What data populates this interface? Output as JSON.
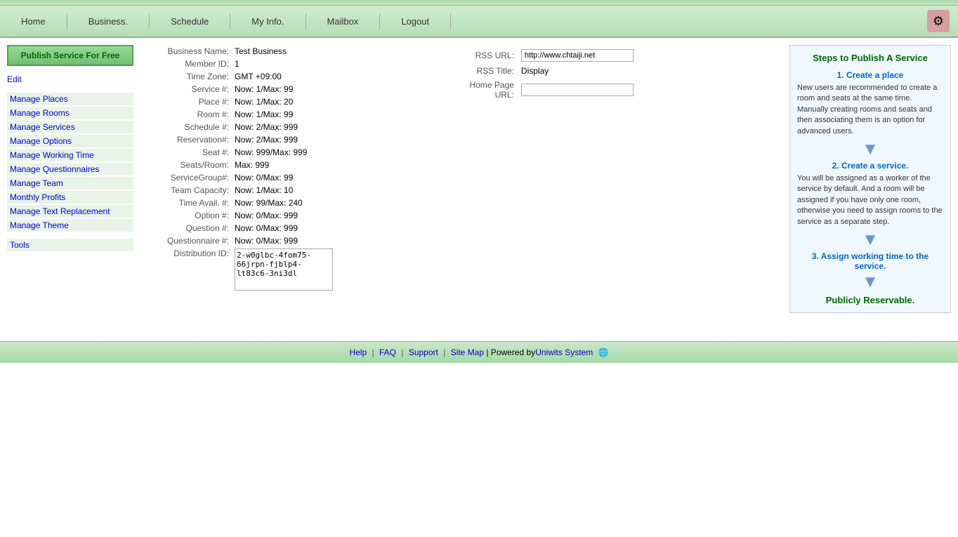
{
  "nav": {
    "items": [
      {
        "label": "Home",
        "href": "#"
      },
      {
        "label": "Business.",
        "href": "#"
      },
      {
        "label": "Schedule",
        "href": "#"
      },
      {
        "label": "My Info.",
        "href": "#"
      },
      {
        "label": "Mailbox",
        "href": "#"
      },
      {
        "label": "Logout",
        "href": "#"
      }
    ]
  },
  "sidebar": {
    "publish_btn": "Publish Service For Free",
    "edit_label": "Edit",
    "links": [
      {
        "label": "Manage Places",
        "href": "#"
      },
      {
        "label": "Manage Rooms",
        "href": "#"
      },
      {
        "label": "Manage Services",
        "href": "#"
      },
      {
        "label": "Manage Options",
        "href": "#"
      },
      {
        "label": "Manage Working Time",
        "href": "#"
      },
      {
        "label": "Manage Questionnaires",
        "href": "#"
      },
      {
        "label": "Manage Team",
        "href": "#"
      },
      {
        "label": "Monthly Profits",
        "href": "#"
      },
      {
        "label": "Manage Text Replacement",
        "href": "#"
      },
      {
        "label": "Manage Theme",
        "href": "#"
      }
    ],
    "tools_label": "Tools"
  },
  "business_info": {
    "fields": [
      {
        "label": "Business Name:",
        "value": "Test Business"
      },
      {
        "label": "Member ID:",
        "value": "1"
      },
      {
        "label": "Time Zone:",
        "value": "GMT +09:00"
      },
      {
        "label": "Service #:",
        "value": "Now: 1/Max: 99"
      },
      {
        "label": "Place #:",
        "value": "Now: 1/Max: 20"
      },
      {
        "label": "Room #:",
        "value": "Now: 1/Max: 99"
      },
      {
        "label": "Schedule #:",
        "value": "Now: 2/Max: 999"
      },
      {
        "label": "Reservation#:",
        "value": "Now: 2/Max: 999"
      },
      {
        "label": "Seat #:",
        "value": "Now: 999/Max: 999"
      },
      {
        "label": "Seats/Room:",
        "value": "Max: 999"
      },
      {
        "label": "ServiceGroup#:",
        "value": "Now: 0/Max: 99"
      },
      {
        "label": "Team Capacity:",
        "value": "Now: 1/Max: 10"
      },
      {
        "label": "Time Avail. #:",
        "value": "Now: 99/Max: 240"
      },
      {
        "label": "Option #:",
        "value": "Now: 0/Max: 999"
      },
      {
        "label": "Question #:",
        "value": "Now: 0/Max: 999"
      },
      {
        "label": "Questionnaire #:",
        "value": "Now: 0/Max: 999"
      },
      {
        "label": "Distribution ID:",
        "value": "2-w0glbc-4fom75-66jrpn-fjblp4-lt83c6-3ni3dl"
      }
    ],
    "rss": {
      "url_label": "RSS URL:",
      "url_value": "http://www.chtaiji.net",
      "title_label": "RSS Title:",
      "title_value": "Display",
      "home_page_label": "Home Page URL:",
      "home_page_value": ""
    }
  },
  "steps": {
    "title": "Steps to Publish A Service",
    "step1_heading": "1. Create a place",
    "step1_text": "New users are recommended to create a room and seats at the same time. Manually creating rooms and seats and then associating them is an option for advanced users.",
    "step2_heading": "2. Create a service.",
    "step2_text": "You will be assigned as a worker of the service by default. And a room will be assigned if you have only one room, otherwise you need to assign rooms to the service as a separate step.",
    "step3_heading": "3. Assign working time to the service.",
    "final_text": "Publicly Reservable."
  },
  "footer": {
    "help": "Help",
    "faq": "FAQ",
    "support": "Support",
    "sitemap": "Site Map",
    "powered_by": "| Powered by",
    "company": "Uniwits System"
  }
}
